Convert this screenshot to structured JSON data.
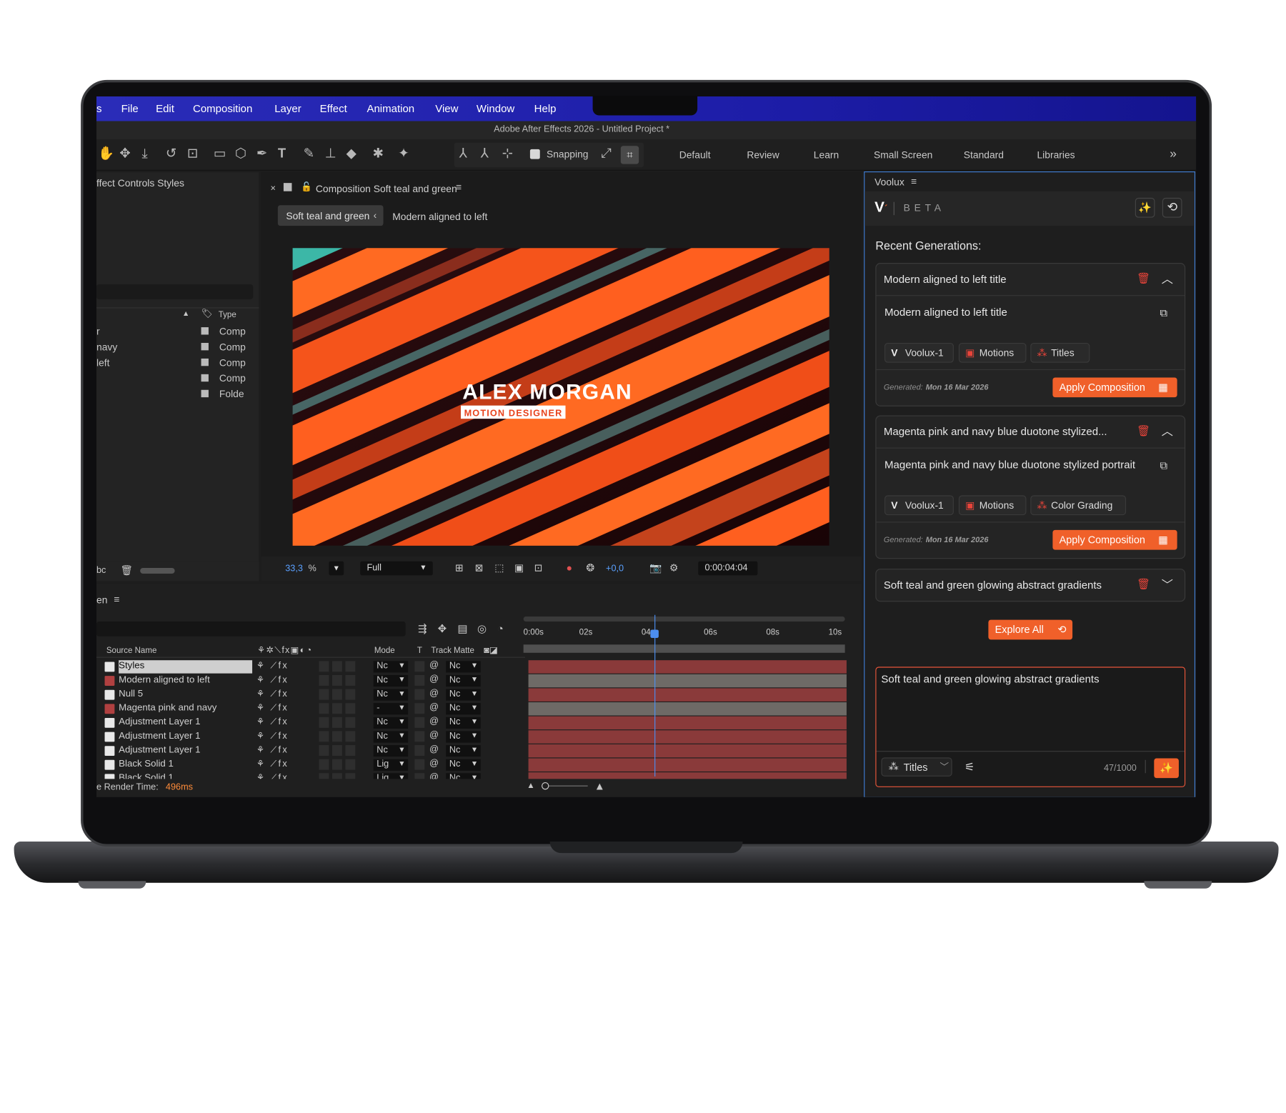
{
  "menubar": {
    "items": [
      "s",
      "File",
      "Edit",
      "Composition",
      "Layer",
      "Effect",
      "Animation",
      "View",
      "Window",
      "Help"
    ]
  },
  "titlebar": {
    "title": "Adobe After Effects 2026 - Untitled Project *"
  },
  "toolbar": {
    "snapping": "Snapping",
    "workspaces": [
      "Default",
      "Review",
      "Learn",
      "Small Screen",
      "Standard",
      "Libraries"
    ],
    "more": "»"
  },
  "project_panel": {
    "title": "ffect Controls Styles",
    "type_header": "Type",
    "rows": [
      {
        "name": "r",
        "type": "Comp"
      },
      {
        "name": "navy",
        "type": "Comp"
      },
      {
        "name": "left",
        "type": "Comp"
      },
      {
        "name": "",
        "type": "Comp"
      },
      {
        "name": "",
        "type": "Folde"
      }
    ],
    "bpc": "bc"
  },
  "comp_panel": {
    "close": "×",
    "title": "Composition Soft teal and green",
    "crumb_active": "Soft teal and green",
    "crumb_next": "Modern aligned to left",
    "headline": "ALEX MORGAN",
    "subline": "MOTION DESIGNER",
    "zoom": "33,3",
    "zoom_unit": "%",
    "quality": "Full",
    "exposure": "+0,0",
    "timecode": "0:00:04:04"
  },
  "timeline": {
    "tab": "en",
    "source_header": "Source Name",
    "mode_header": "Mode",
    "t_header": "T",
    "track_matte_header": "Track Matte",
    "ticks": [
      "0:00s",
      "02s",
      "04s",
      "06s",
      "08s",
      "10s"
    ],
    "layers": [
      {
        "name": "Styles",
        "mode": "Nc",
        "matte": "Nc"
      },
      {
        "name": "Modern aligned to left",
        "mode": "Nc",
        "matte": "Nc"
      },
      {
        "name": "Null 5",
        "mode": "Nc",
        "matte": "Nc"
      },
      {
        "name": "Magenta pink and navy",
        "mode": "-",
        "matte": "Nc"
      },
      {
        "name": "Adjustment Layer 1",
        "mode": "Nc",
        "matte": "Nc"
      },
      {
        "name": "Adjustment Layer 1",
        "mode": "Nc",
        "matte": "Nc"
      },
      {
        "name": "Adjustment Layer 1",
        "mode": "Nc",
        "matte": "Nc"
      },
      {
        "name": "Black Solid 1",
        "mode": "Lig",
        "matte": "Nc"
      },
      {
        "name": "Black Solid 1",
        "mode": "Lig",
        "matte": "Nc"
      }
    ],
    "render_label": "e Render Time:",
    "render_value": "496ms"
  },
  "voolux": {
    "panel_title": "Voolux",
    "beta": "BETA",
    "recent_title": "Recent Generations:",
    "cards": [
      {
        "title": "Modern aligned to left title",
        "prompt": "Modern aligned to left title",
        "tags": [
          "Voolux-1",
          "Motions",
          "Titles"
        ],
        "generated_label": "Generated:",
        "generated_date": "Mon 16 Mar 2026",
        "apply": "Apply Composition"
      },
      {
        "title": "Magenta pink and navy blue duotone stylized...",
        "prompt": "Magenta pink and navy blue duotone stylized portrait",
        "tags": [
          "Voolux-1",
          "Motions",
          "Color Grading"
        ],
        "generated_label": "Generated:",
        "generated_date": "Mon 16 Mar 2026",
        "apply": "Apply Composition"
      },
      {
        "title": "Soft teal and green glowing abstract gradients"
      }
    ],
    "explore": "Explore All",
    "input_value": "Soft teal and green glowing abstract gradients",
    "category": "Titles",
    "char_count": "47/1000"
  },
  "colors": {
    "accent": "#f0602a",
    "selection": "#3f7cd1",
    "menubar": "#1d1da8"
  }
}
